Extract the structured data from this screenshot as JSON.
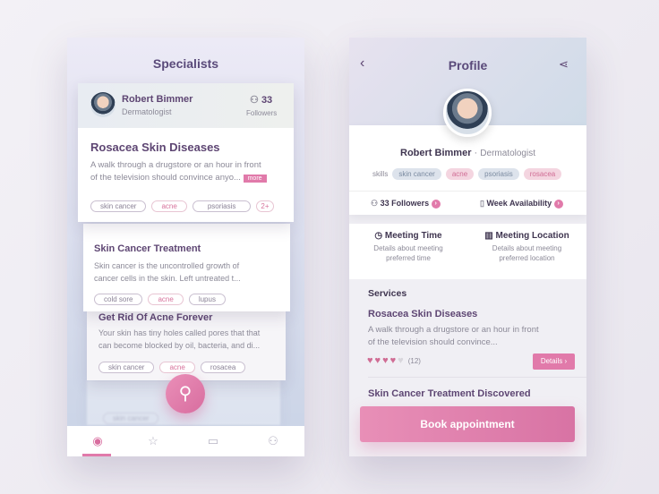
{
  "left": {
    "title": "Specialists",
    "doctor": {
      "name": "Robert Bimmer",
      "role": "Dermatologist",
      "followers_count": "33",
      "followers_label": "Followers"
    },
    "cards": [
      {
        "title": "Rosacea Skin Diseases",
        "desc1": "A walk through a drugstore or an hour in front",
        "desc2": "of the television should convince anyo...",
        "more": "more",
        "tags": [
          "skin cancer",
          "acne",
          "psoriasis",
          "2+"
        ]
      },
      {
        "title": "Skin Cancer Treatment",
        "desc1": "Skin cancer is the uncontrolled growth of",
        "desc2": "cancer cells in the skin. Left untreated t...",
        "tags": [
          "cold sore",
          "acne",
          "lupus"
        ]
      },
      {
        "title": "Get Rid Of Acne Forever",
        "desc1": "Your skin has tiny holes called pores that that",
        "desc2": "can become blocked by oil, bacteria, and di...",
        "tags": [
          "skin cancer",
          "acne",
          "rosacea"
        ]
      },
      {
        "tags": [
          "skin cancer"
        ]
      }
    ],
    "tabs": [
      "eye-icon",
      "star-icon",
      "chat-icon",
      "user-icon"
    ],
    "active_tab": 0
  },
  "right": {
    "title": "Profile",
    "name": "Robert Bimmer",
    "role": "Dermatologist",
    "skills_label": "skills",
    "skills": [
      "skin cancer",
      "acne",
      "psoriasis",
      "rosacea"
    ],
    "followers": "33 Followers",
    "availability": "Week Availability",
    "meeting_time": {
      "title": "Meeting Time",
      "desc1": "Details about meeting",
      "desc2": "preferred time"
    },
    "meeting_location": {
      "title": "Meeting Location",
      "desc1": "Details about meeting",
      "desc2": "preferred location"
    },
    "services_label": "Services",
    "service1": {
      "title": "Rosacea Skin Diseases",
      "desc1": "A walk through a drugstore or an hour in front",
      "desc2": "of the television should convince...",
      "rating": 4,
      "max_rating": 5,
      "reviews": "(12)",
      "details": "Details"
    },
    "service2": {
      "title": "Skin Cancer Treatment Discovered"
    },
    "book": "Book appointment"
  },
  "colors": {
    "accent": "#e17aaa",
    "title": "#5e4673"
  }
}
